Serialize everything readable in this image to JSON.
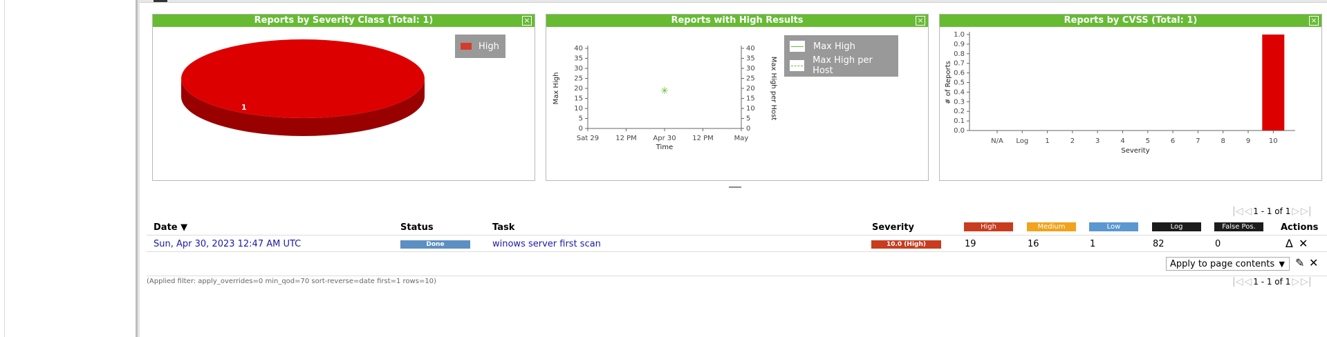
{
  "panels": {
    "severity_class": {
      "title": "Reports by Severity Class (Total: 1)",
      "close_label": "×",
      "legend": [
        {
          "label": "High",
          "color": "#d63c2b"
        }
      ],
      "slice_label": "1"
    },
    "high_results": {
      "title": "Reports with High Results",
      "close_label": "×",
      "legend": [
        {
          "label": "Max High"
        },
        {
          "label": "Max High per Host"
        }
      ]
    },
    "cvss": {
      "title": "Reports by CVSS (Total: 1)",
      "close_label": "×"
    }
  },
  "chart_data": [
    {
      "type": "pie",
      "title": "Reports by Severity Class (Total: 1)",
      "slices": [
        {
          "label": "High",
          "value": 1,
          "color": "#dd0000"
        }
      ]
    },
    {
      "type": "scatter",
      "title": "Reports with High Results",
      "xlabel": "Time",
      "ylabel": "Max High",
      "y2label": "Max High per Host",
      "x_ticks": [
        "Sat 29",
        "12 PM",
        "Apr 30",
        "12 PM",
        "May"
      ],
      "y_ticks": [
        "0",
        "5",
        "10",
        "15",
        "20",
        "25",
        "30",
        "35",
        "40"
      ],
      "ylim": [
        0,
        40
      ],
      "series": [
        {
          "name": "Max High",
          "points": [
            {
              "x": "Apr 30",
              "y": 19
            }
          ]
        }
      ]
    },
    {
      "type": "bar",
      "title": "Reports by CVSS (Total: 1)",
      "xlabel": "Severity",
      "ylabel": "# of Reports",
      "categories": [
        "N/A",
        "Log",
        "1",
        "2",
        "3",
        "4",
        "5",
        "6",
        "7",
        "8",
        "9",
        "10"
      ],
      "values": [
        0,
        0,
        0,
        0,
        0,
        0,
        0,
        0,
        0,
        0,
        0,
        1
      ],
      "y_ticks": [
        "0.0",
        "0.1",
        "0.2",
        "0.3",
        "0.4",
        "0.5",
        "0.6",
        "0.7",
        "0.8",
        "0.9",
        "1.0"
      ],
      "ylim": [
        0,
        1
      ],
      "bar_color": "#dd0000"
    }
  ],
  "pagination": {
    "text": "1 - 1 of 1"
  },
  "table": {
    "headers": {
      "date": "Date ▼",
      "status": "Status",
      "task": "Task",
      "severity": "Severity",
      "actions": "Actions"
    },
    "categories": [
      {
        "label": "High",
        "color": "#c83c1f"
      },
      {
        "label": "Medium",
        "color": "#f0a31b"
      },
      {
        "label": "Low",
        "color": "#5b97d0"
      },
      {
        "label": "Log",
        "color": "#1c1c1c"
      },
      {
        "label": "False Pos.",
        "color": "#1c1c1c"
      }
    ],
    "row": {
      "date": "Sun, Apr 30, 2023 12:47 AM UTC",
      "status": "Done",
      "task": "winows server first scan",
      "severity": "10.0 (High)",
      "high": "19",
      "medium": "16",
      "low": "1",
      "log": "82",
      "false_pos": "0"
    }
  },
  "bulk": {
    "apply_label": "Apply to page contents"
  },
  "filter_text": "(Applied filter: apply_overrides=0 min_qod=70 sort-reverse=date first=1 rows=10)"
}
